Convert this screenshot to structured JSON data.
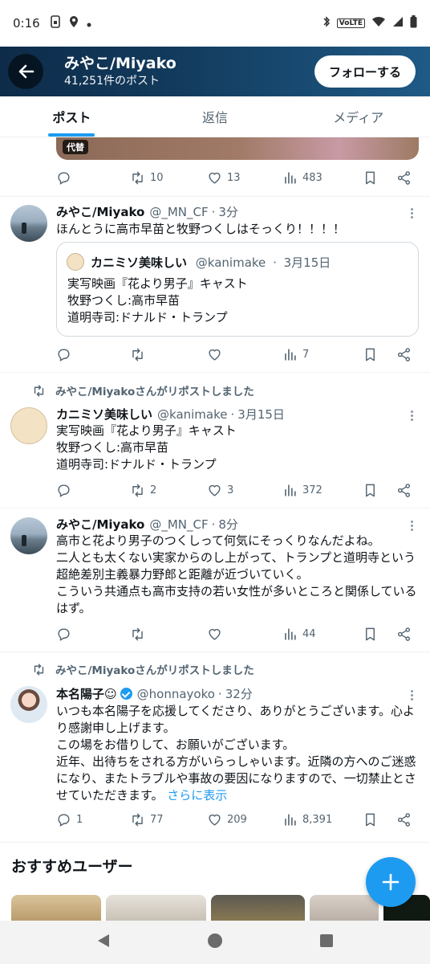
{
  "status_bar": {
    "time": "0:16",
    "volte_label": "VoLTE",
    "icons_left": [
      "phone-lock-icon",
      "location-icon",
      "dot-icon"
    ],
    "icons_right": [
      "bluetooth-icon",
      "volte-icon",
      "wifi-icon",
      "signal-icon",
      "battery-icon"
    ]
  },
  "header": {
    "name": "みやこ/Miyako",
    "post_count": "41,251件のポスト",
    "follow_label": "フォローする",
    "gradient_colors": [
      "#0e2c4a",
      "#1f5a86"
    ]
  },
  "tabs": [
    {
      "label": "ポスト",
      "active": true
    },
    {
      "label": "返信",
      "active": false
    },
    {
      "label": "メディア",
      "active": false
    }
  ],
  "accent_color": "#1d9bf0",
  "media_badge": "代替",
  "posts": [
    {
      "actions": {
        "replies": "",
        "reposts": "10",
        "likes": "13",
        "views": "483"
      }
    },
    {
      "name": "みやこ/Miyako",
      "handle": "@_MN_CF",
      "time": "3分",
      "text": "ほんとうに高市早苗と牧野つくしはそっくり！！！！",
      "quote": {
        "name": "カニミソ美味しい",
        "handle": "@kanimake",
        "date": "3月15日",
        "text": "実写映画『花より男子』キャスト\n牧野つくし:高市早苗\n道明寺司:ドナルド・トランプ"
      },
      "actions": {
        "replies": "",
        "reposts": "",
        "likes": "",
        "views": "7"
      }
    },
    {
      "repost_by": "みやこ/Miyakoさんがリポストしました",
      "name": "カニミソ美味しい",
      "handle": "@kanimake",
      "time": "3月15日",
      "text": "実写映画『花より男子』キャスト\n牧野つくし:高市早苗\n道明寺司:ドナルド・トランプ",
      "actions": {
        "replies": "",
        "reposts": "2",
        "likes": "3",
        "views": "372"
      }
    },
    {
      "name": "みやこ/Miyako",
      "handle": "@_MN_CF",
      "time": "8分",
      "text": "高市と花より男子のつくしって何気にそっくりなんだよね。\n二人とも太くない実家からのし上がって、トランプと道明寺という超絶差別主義暴力野郎と距離が近づいていく。\nこういう共通点も高市支持の若い女性が多いところと関係しているはず。",
      "actions": {
        "replies": "",
        "reposts": "",
        "likes": "",
        "views": "44"
      }
    },
    {
      "repost_by": "みやこ/Miyakoさんがリポストしました",
      "name": "本名陽子☺",
      "handle": "@honnayoko",
      "time": "32分",
      "text": "いつも本名陽子を応援してくださり、ありがとうございます。心より感謝申し上げます。\nこの場をお借りして、お願いがございます。\n近年、出待ちをされる方がいらっしゃいます。近隣の方へのご迷惑になり、またトラブルや事故の要因になりますので、一切禁止とさせていただきます。",
      "show_more": "さらに表示",
      "actions": {
        "replies": "1",
        "reposts": "77",
        "likes": "209",
        "views": "8,391"
      }
    }
  ],
  "recommended": {
    "title": "おすすめユーザー"
  }
}
